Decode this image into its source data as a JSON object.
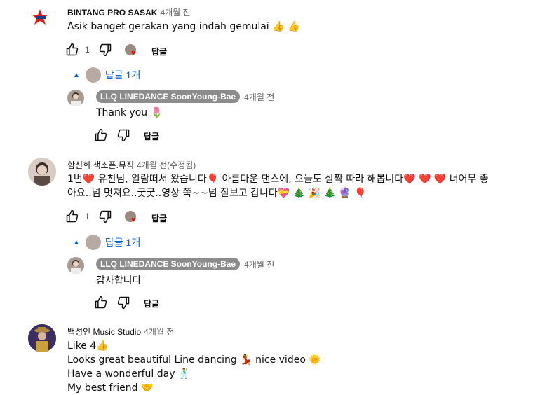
{
  "comments": [
    {
      "author": "BINTANG PRO SASAK",
      "time": "4개월 전",
      "text": "Asik banget gerakan yang indah gemulai 👍 👍",
      "likes": "1",
      "reply_label": "답글",
      "replies_toggle": "답글 1개",
      "reply": {
        "author": "LLQ LINEDANCE SoonYoung-Bae",
        "time": "4개월 전",
        "text": "Thank you 🌷",
        "reply_label": "답글"
      }
    },
    {
      "author": "함신희 색소폰.뮤직",
      "time": "4개월 전(수정됨)",
      "text_line1": "1번❤️ 유친님, 알람떠서 왔습니다🎈 아름다운 댄스에, 오늘도 살짝 따라 해봅니다❤️ ❤️ ❤️  너어무 좋",
      "text_line2": "아요..넘 멋져요..굿굿..영상 쭉~~넘 잘보고 갑니다💝 🎄 🎉 🎄 🔮 🎈",
      "likes": "1",
      "reply_label": "답글",
      "replies_toggle": "답글 1개",
      "reply": {
        "author": "LLQ LINEDANCE SoonYoung-Bae",
        "time": "4개월 전",
        "text": "감사합니다",
        "reply_label": "답글"
      }
    },
    {
      "author": "백성인 Music Studio",
      "time": "4개월 전",
      "lines": [
        "Like  4👍",
        "Looks great beautiful Line dancing 💃 nice video 🌞",
        "Have a wonderful day 🕺",
        "My best friend 🤝"
      ]
    }
  ],
  "colors": {
    "link": "#065fd4",
    "heart": "#ff0000",
    "muted": "#606060"
  }
}
